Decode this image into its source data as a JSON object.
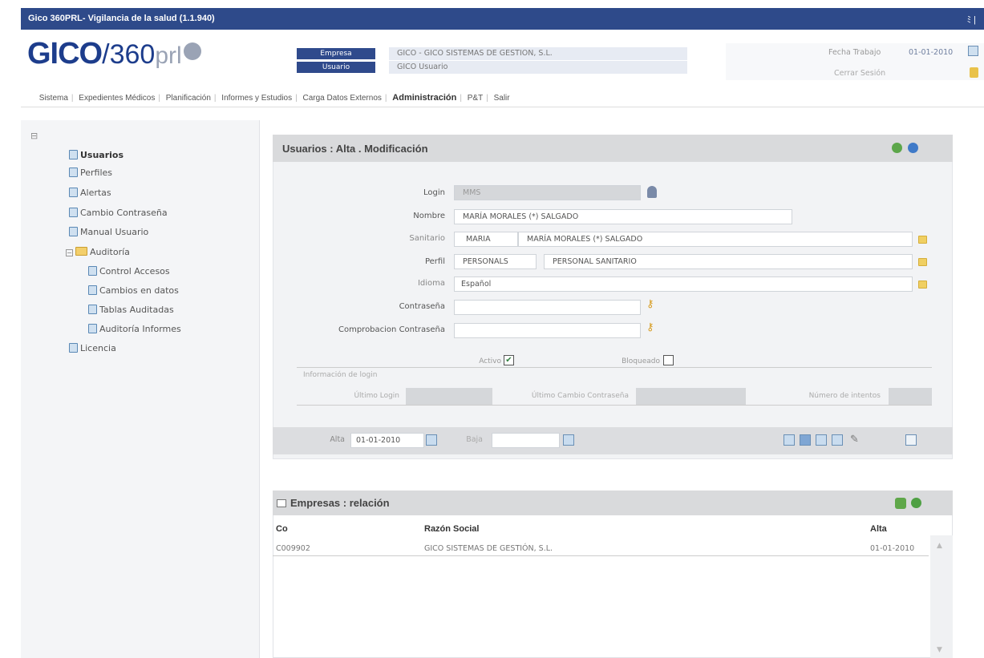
{
  "window": {
    "title": "Gico 360PRL- Vigilancia de la salud (1.1.940)",
    "top_right": "ﾐ |"
  },
  "logo": {
    "gico": "GICO",
    "slash": "/",
    "num": "360",
    "prl": "prl"
  },
  "header": {
    "empresa_label": "Empresa",
    "empresa_value": "GICO - GICO SISTEMAS DE GESTION, S.L.",
    "usuario_label": "Usuario",
    "usuario_value": "GICO Usuario",
    "fecha_label": "Fecha Trabajo",
    "fecha_value": "01-01-2010",
    "cerrar": "Cerrar Sesión"
  },
  "menu": [
    "Sistema",
    "Expedientes Médicos",
    "Planificación",
    "Informes y Estudios",
    "Carga Datos Externos",
    "Administración",
    "P&T",
    "Salir"
  ],
  "tree": {
    "root": "⊟",
    "items": [
      "Usuarios",
      "Perfiles",
      "Alertas",
      "Cambio Contraseña",
      "Manual Usuario"
    ],
    "folder": "Auditoría",
    "subitems": [
      "Control Accesos",
      "Cambios en datos",
      "Tablas Auditadas",
      "Auditoría Informes"
    ],
    "last": "Licencia"
  },
  "form": {
    "title": "Usuarios : Alta . Modificación",
    "login_label": "Login",
    "login_value": "MMS",
    "nombre_label": "Nombre",
    "nombre_value": "MARÍA MORALES (*) SALGADO",
    "sanitario_label": "Sanitario",
    "sanitario_code": "MARIA",
    "sanitario_name": "MARÍA MORALES (*) SALGADO",
    "perfil_label": "Perfil",
    "perfil_code": "PERSONALS",
    "perfil_name": "PERSONAL SANITARIO",
    "idioma_label": "Idioma",
    "idioma_value": "Español",
    "pass_label": "Contraseña",
    "pass_value": "",
    "pass2_label": "Comprobacion Contraseña",
    "pass2_value": "",
    "activo_label": "Activo",
    "activo_checked": true,
    "bloqueado_label": "Bloqueado",
    "bloqueado_checked": false,
    "info_label": "Información de login",
    "ultimo_login_label": "Último Login",
    "ultimo_cambio_label": "Último Cambio Contraseña",
    "intentos_label": "Número de intentos",
    "alta_label": "Alta",
    "alta_value": "01-01-2010",
    "baja_label": "Baja",
    "baja_value": ""
  },
  "empresas": {
    "title": "Empresas : relación",
    "columns": [
      "Co",
      "Razón Social",
      "Alta"
    ],
    "rows": [
      {
        "co": "C009902",
        "razon": "GICO SISTEMAS DE GESTIÓN, S.L.",
        "alta": "01-01-2010"
      }
    ]
  },
  "colors": {
    "titlebar": "#2e4a8a",
    "label_badge": "#2f4a8c",
    "panel_header": "#d9dadc",
    "sidebar": "#f4f5f7"
  }
}
